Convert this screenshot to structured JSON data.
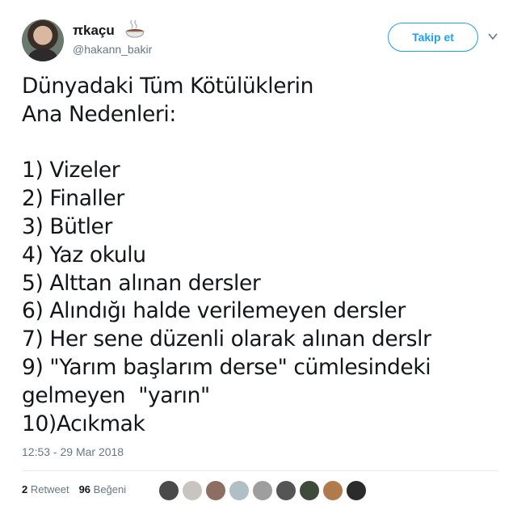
{
  "user": {
    "display_name": "πkaçu",
    "handle": "@hakann_bakir",
    "emoji_icon": "coffee-icon"
  },
  "follow_button": {
    "label": "Takip et"
  },
  "tweet": {
    "text": "Dünyadaki Tüm Kötülüklerin\nAna Nedenleri:\n\n1) Vizeler\n2) Finaller\n3) Bütler\n4) Yaz okulu\n5) Alttan alınan dersler\n6) Alındığı halde verilemeyen dersler\n7) Her sene düzenli olarak alınan derslr\n9) \"Yarım başlarım derse\" cümlesindeki\ngelmeyen  \"yarın\"\n10)Acıkmak",
    "timestamp": "12:53 - 29 Mar 2018"
  },
  "stats": {
    "retweet_count": "2",
    "retweet_label": "Retweet",
    "like_count": "96",
    "like_label": "Beğeni"
  },
  "liker_colors": [
    "#4a4a4a",
    "#c9c4c0",
    "#8d6e63",
    "#b0bec5",
    "#9e9e9e",
    "#555555",
    "#3e4a3a",
    "#b07a4a",
    "#2b2b2b"
  ],
  "colors": {
    "accent": "#1da1f2",
    "muted": "#657786",
    "text": "#14171a"
  }
}
